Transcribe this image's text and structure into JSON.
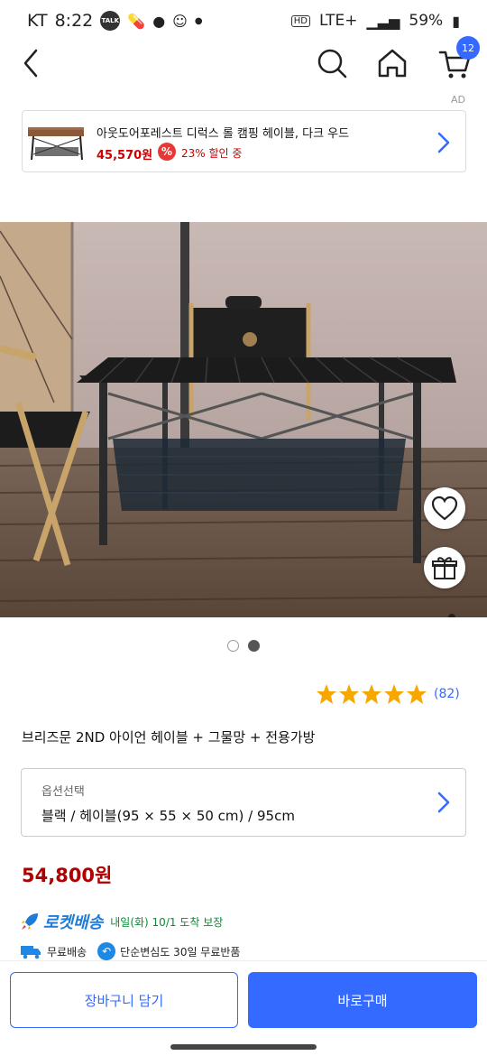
{
  "status_bar": {
    "carrier": "KT",
    "time": "8:22",
    "network": "LTE+",
    "battery": "59%"
  },
  "header": {
    "cart_count": "12"
  },
  "ad": {
    "label": "AD",
    "title": "아웃도어포레스트 디럭스 롤 캠핑 헤이블, 다크 우드",
    "price": "45,570원",
    "discount_badge": "%",
    "discount_text": "23% 할인 중"
  },
  "gallery": {
    "total": 2,
    "active_index": 2
  },
  "product": {
    "rating_stars": 5,
    "review_count": "(82)",
    "title": "브리즈문 2ND 아이언 헤이블 + 그물망 + 전용가방",
    "price": "54,800원"
  },
  "option": {
    "label": "옵션선택",
    "value": "블랙 / 헤이블(95 × 55 × 50 cm) / 95cm"
  },
  "delivery": {
    "rocket_label": "로켓배송",
    "eta": "내일(화) 10/1 도착 보장",
    "free_shipping": "무료배송",
    "free_return": "단순변심도 30일 무료반품"
  },
  "bottom_bar": {
    "cart_button": "장바구니 담기",
    "buy_button": "바로구매"
  },
  "colors": {
    "accent": "#346aff",
    "price": "#ae0000",
    "star": "#f6a800"
  }
}
